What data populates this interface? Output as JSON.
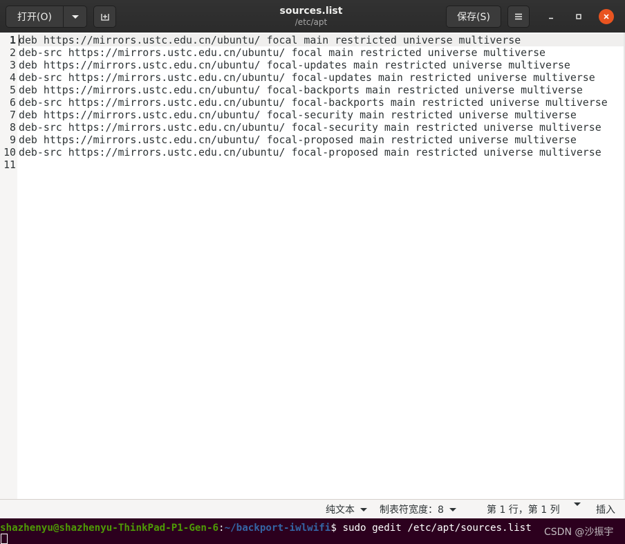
{
  "window": {
    "title": "sources.list",
    "subtitle": "/etc/apt"
  },
  "toolbar": {
    "open_label": "打开(O)",
    "save_label": "保存(S)"
  },
  "editor": {
    "line_numbers": [
      "1",
      "2",
      "3",
      "4",
      "5",
      "6",
      "7",
      "8",
      "9",
      "10",
      "11"
    ],
    "lines": [
      "deb https://mirrors.ustc.edu.cn/ubuntu/ focal main restricted universe multiverse",
      "deb-src https://mirrors.ustc.edu.cn/ubuntu/ focal main restricted universe multiverse",
      "deb https://mirrors.ustc.edu.cn/ubuntu/ focal-updates main restricted universe multiverse",
      "deb-src https://mirrors.ustc.edu.cn/ubuntu/ focal-updates main restricted universe multiverse",
      "deb https://mirrors.ustc.edu.cn/ubuntu/ focal-backports main restricted universe multiverse",
      "deb-src https://mirrors.ustc.edu.cn/ubuntu/ focal-backports main restricted universe multiverse",
      "deb https://mirrors.ustc.edu.cn/ubuntu/ focal-security main restricted universe multiverse",
      "deb-src https://mirrors.ustc.edu.cn/ubuntu/ focal-security main restricted universe multiverse",
      "deb https://mirrors.ustc.edu.cn/ubuntu/ focal-proposed main restricted universe multiverse",
      "deb-src https://mirrors.ustc.edu.cn/ubuntu/ focal-proposed main restricted universe multiverse",
      ""
    ]
  },
  "statusbar": {
    "language": "纯文本",
    "tab_width": "制表符宽度：8",
    "position": "第 1 行，第 1 列",
    "mode": "插入"
  },
  "terminal": {
    "user_host": "shazhenyu@shazhenyu-ThinkPad-P1-Gen-6",
    "colon": ":",
    "path": "~/backport-iwlwifi",
    "prompt": "$ ",
    "command": "sudo gedit /etc/apt/sources.list"
  },
  "watermark": "CSDN @沙振宇",
  "colors": {
    "headerbar": "#2b2b2b",
    "close_button": "#e95420",
    "terminal_bg": "#2c001e"
  }
}
